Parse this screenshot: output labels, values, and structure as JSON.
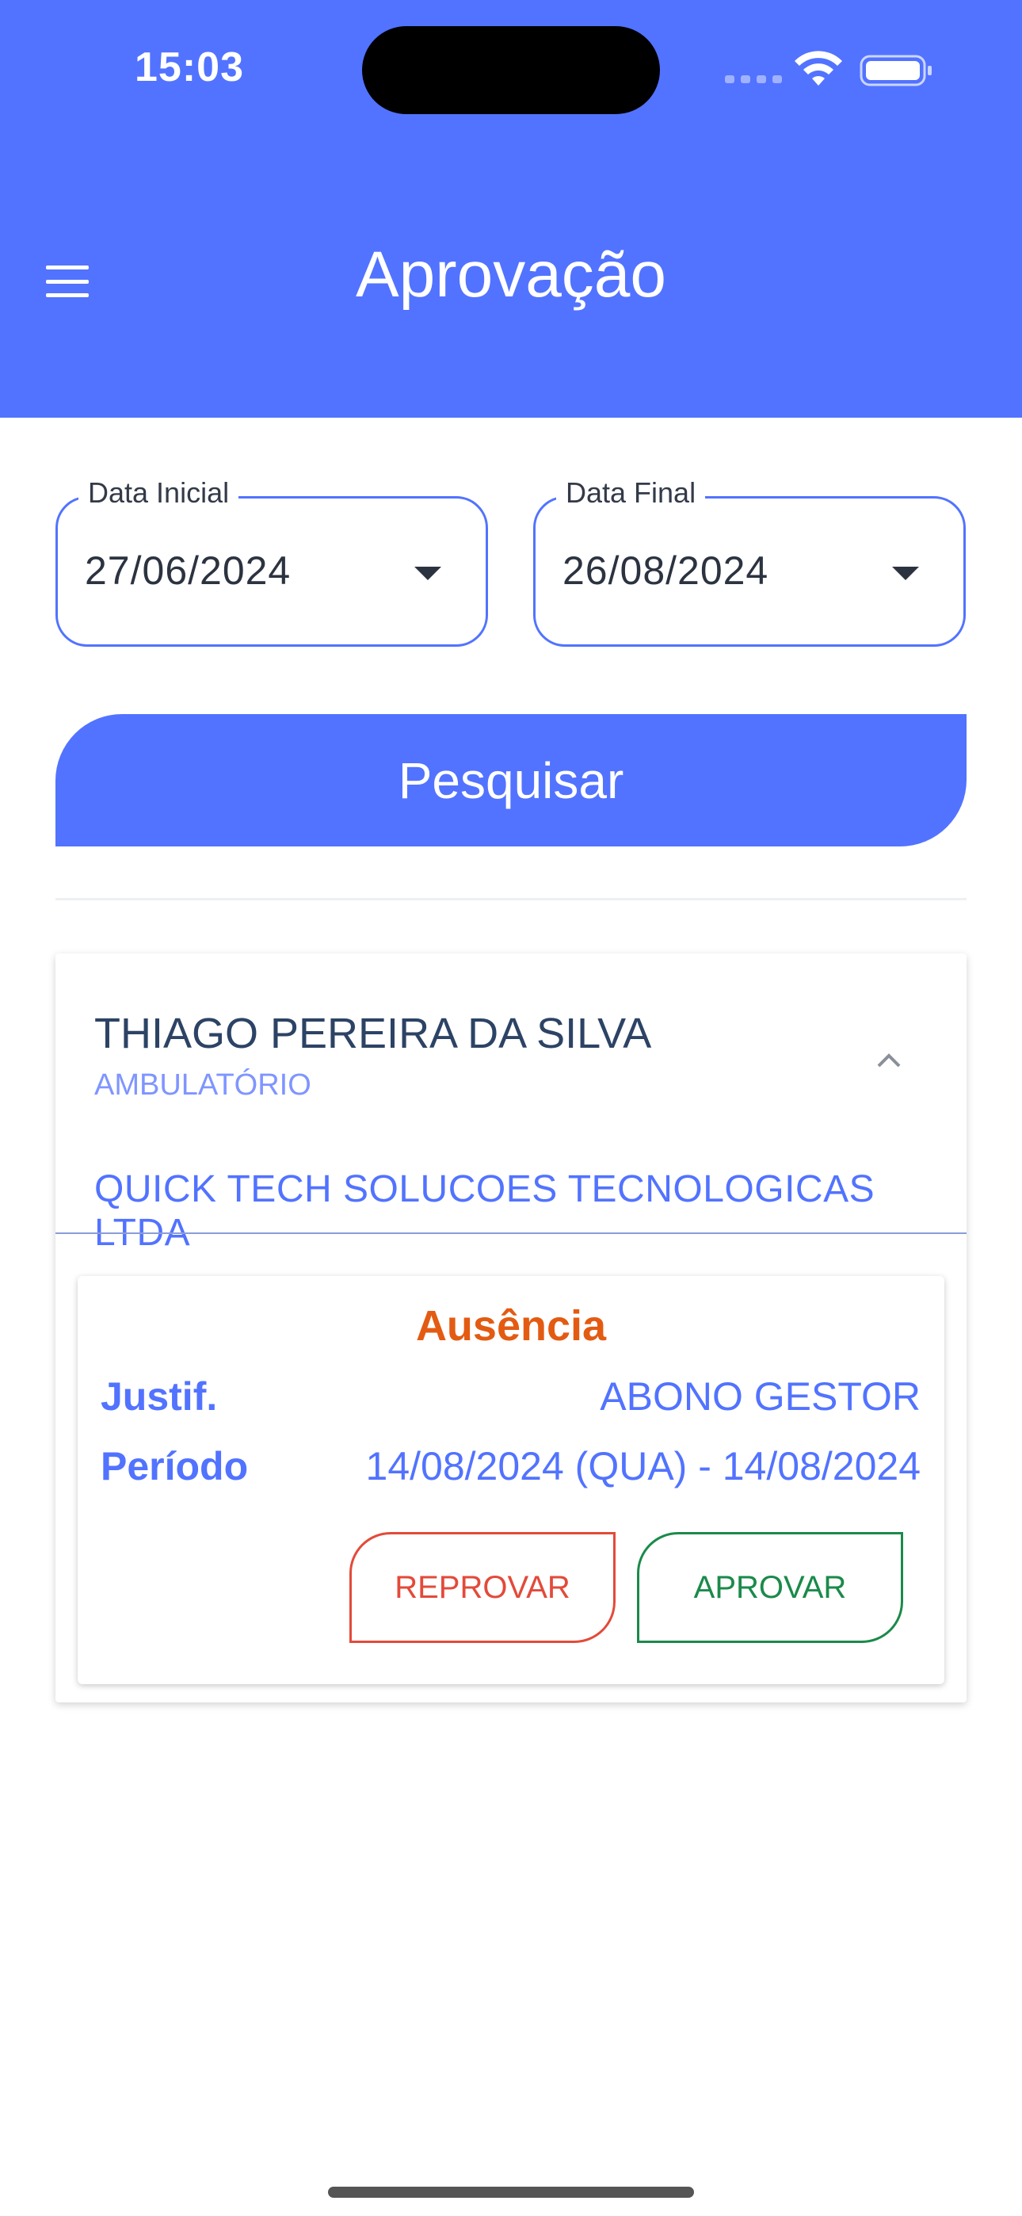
{
  "status_bar": {
    "time": "15:03"
  },
  "header": {
    "title": "Aprovação"
  },
  "filters": {
    "initial": {
      "label": "Data Inicial",
      "value": "27/06/2024"
    },
    "final": {
      "label": "Data Final",
      "value": "26/08/2024"
    }
  },
  "search_button": {
    "label": "Pesquisar"
  },
  "colors": {
    "primary": "#5273ff",
    "absence": "#e35b12",
    "reject": "#e34a3a",
    "approve": "#1b8a4a"
  },
  "employee": {
    "name": "THIAGO PEREIRA DA SILVA",
    "department": "AMBULATÓRIO",
    "company": "QUICK TECH SOLUCOES TECNOLOGICAS LTDA",
    "request": {
      "type": "Ausência",
      "justification_label": "Justif.",
      "justification_value": "ABONO GESTOR",
      "period_label": "Período",
      "period_value": "14/08/2024 (QUA) - 14/08/2024",
      "reject_label": "REPROVAR",
      "approve_label": "APROVAR"
    }
  }
}
